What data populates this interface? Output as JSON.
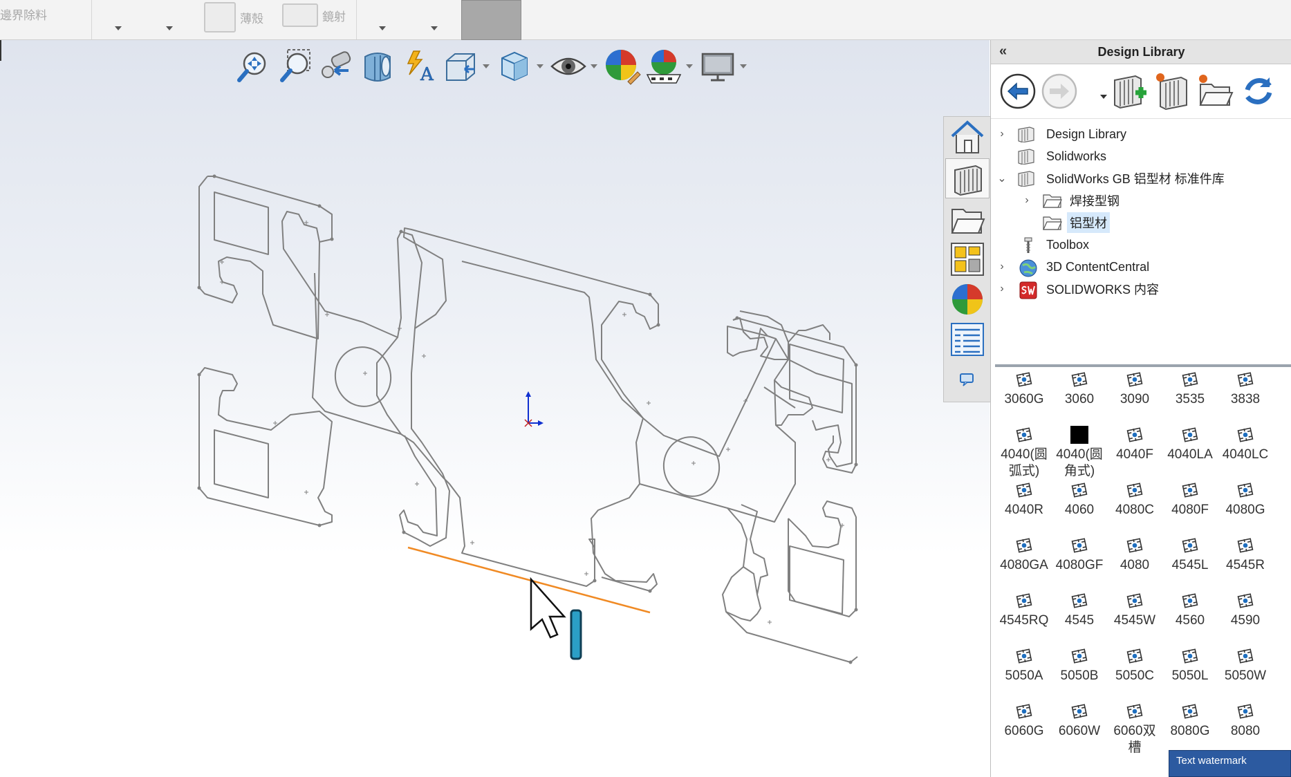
{
  "ribbon": {
    "items": [
      {
        "label": "邊界除料",
        "icon": "boundary-cut-icon"
      },
      {
        "label": "薄殼",
        "icon": "shell-icon"
      },
      {
        "label": "鏡射",
        "icon": "mirror-icon"
      }
    ]
  },
  "hud": {
    "tools": [
      {
        "name": "zoom-to-fit-icon"
      },
      {
        "name": "zoom-to-area-icon"
      },
      {
        "name": "previous-view-icon"
      },
      {
        "name": "section-view-icon"
      },
      {
        "name": "dynamic-annotation-icon"
      },
      {
        "name": "view-orientation-icon",
        "dropdown": true
      },
      {
        "name": "display-style-icon",
        "dropdown": true
      },
      {
        "name": "hide-show-items-icon",
        "dropdown": true
      },
      {
        "name": "edit-appearance-icon"
      },
      {
        "name": "apply-scene-icon",
        "dropdown": true
      },
      {
        "name": "view-settings-icon",
        "dropdown": true
      }
    ]
  },
  "task_pane": {
    "tabs": [
      {
        "name": "solidworks-resources-icon"
      },
      {
        "name": "design-library-icon",
        "active": true
      },
      {
        "name": "file-explorer-icon"
      },
      {
        "name": "view-palette-icon"
      },
      {
        "name": "appearances-scenes-icon"
      },
      {
        "name": "custom-properties-icon"
      },
      {
        "name": "forum-icon"
      }
    ]
  },
  "panel": {
    "title": "Design Library",
    "collapse_glyph": "«",
    "toolbar": [
      {
        "name": "back-icon"
      },
      {
        "name": "forward-icon"
      },
      {
        "name": "add-to-library-icon"
      },
      {
        "name": "add-file-location-icon"
      },
      {
        "name": "create-new-folder-icon"
      },
      {
        "name": "refresh-icon"
      }
    ],
    "tree": [
      {
        "label": "Design Library",
        "level": 0,
        "arrow": "›",
        "icon": "library-icon"
      },
      {
        "label": "Solidworks",
        "level": 0,
        "arrow": "",
        "icon": "library-icon"
      },
      {
        "label": "SolidWorks GB 铝型材 标准件库",
        "level": 0,
        "arrow": "⌄",
        "icon": "library-icon"
      },
      {
        "label": "焊接型钢",
        "level": 1,
        "arrow": "›",
        "icon": "folder-icon"
      },
      {
        "label": "铝型材",
        "level": 1,
        "arrow": "",
        "icon": "folder-icon",
        "selected": true
      },
      {
        "label": "Toolbox",
        "level": 0,
        "arrow": "",
        "icon": "toolbox-icon"
      },
      {
        "label": "3D ContentCentral",
        "level": 0,
        "arrow": "›",
        "icon": "globe-icon"
      },
      {
        "label": "SOLIDWORKS 内容",
        "level": 0,
        "arrow": "›",
        "icon": "sw-icon"
      }
    ],
    "items": [
      "3060G",
      "3060",
      "3090",
      "3535",
      "3838",
      "4040(圆弧式)",
      "4040(圆角式)",
      "4040F",
      "4040LA",
      "4040LC",
      "4040R",
      "4060",
      "4080C",
      "4080F",
      "4080G",
      "4080GA",
      "4080GF",
      "4080",
      "4545L",
      "4545R",
      "4545RQ",
      "4545",
      "4545W",
      "4560",
      "4590",
      "5050A",
      "5050B",
      "5050C",
      "5050L",
      "5050W",
      "6060G",
      "6060W",
      "6060双槽",
      "8080G",
      "8080"
    ]
  },
  "watermark": "Text watermark",
  "colors": {
    "selected_edge": "#f08a24",
    "sketch": "#808080",
    "panel_header": "#e4e4e4"
  }
}
